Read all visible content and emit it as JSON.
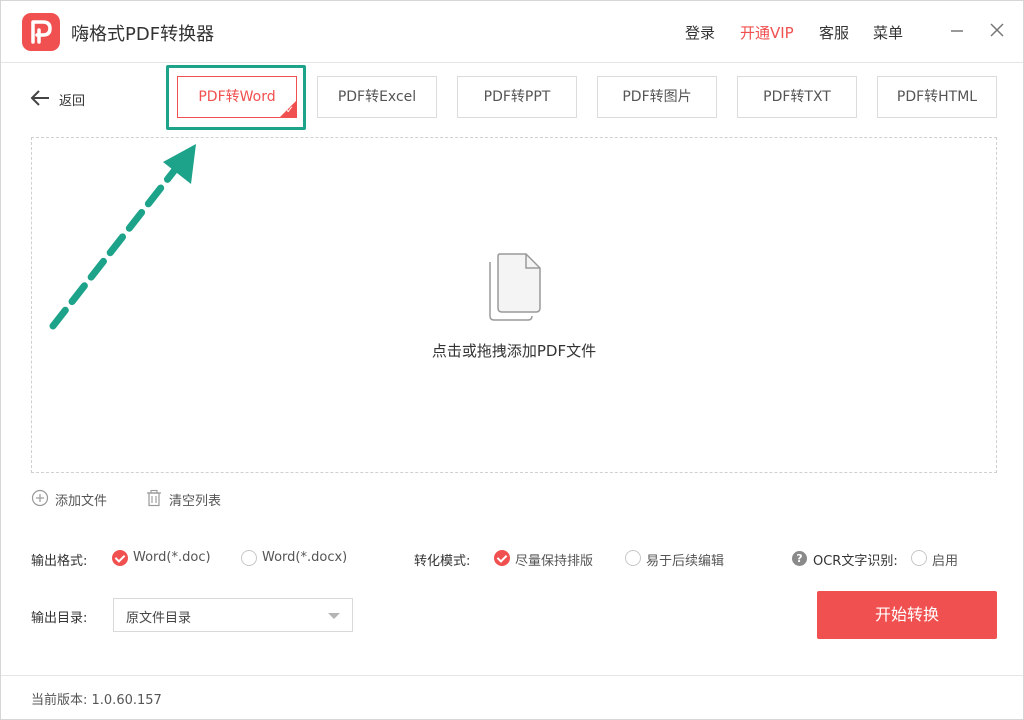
{
  "app": {
    "title": "嗨格式PDF转换器",
    "menu": {
      "login": "登录",
      "vip": "开通VIP",
      "service": "客服",
      "menu": "菜单"
    }
  },
  "nav": {
    "back_label": "返回"
  },
  "tabs": [
    {
      "label": "PDF转Word",
      "active": true
    },
    {
      "label": "PDF转Excel",
      "active": false
    },
    {
      "label": "PDF转PPT",
      "active": false
    },
    {
      "label": "PDF转图片",
      "active": false
    },
    {
      "label": "PDF转TXT",
      "active": false
    },
    {
      "label": "PDF转HTML",
      "active": false
    }
  ],
  "dropzone": {
    "hint": "点击或拖拽添加PDF文件"
  },
  "file_actions": {
    "add": "添加文件",
    "clear": "清空列表"
  },
  "options": {
    "output_format_label": "输出格式:",
    "formats": [
      {
        "label": "Word(*.doc)",
        "checked": true
      },
      {
        "label": "Word(*.docx)",
        "checked": false
      }
    ],
    "mode_label": "转化模式:",
    "modes": [
      {
        "label": "尽量保持排版",
        "checked": true
      },
      {
        "label": "易于后续编辑",
        "checked": false
      }
    ],
    "ocr_label": "OCR文字识别:",
    "ocr_option": {
      "label": "启用",
      "checked": false
    },
    "output_dir_label": "输出目录:",
    "output_dir_value": "原文件目录"
  },
  "actions": {
    "start": "开始转换"
  },
  "footer": {
    "version": "当前版本: 1.0.60.157"
  },
  "colors": {
    "accent": "#f0504f",
    "annotation": "#1ca38a"
  }
}
